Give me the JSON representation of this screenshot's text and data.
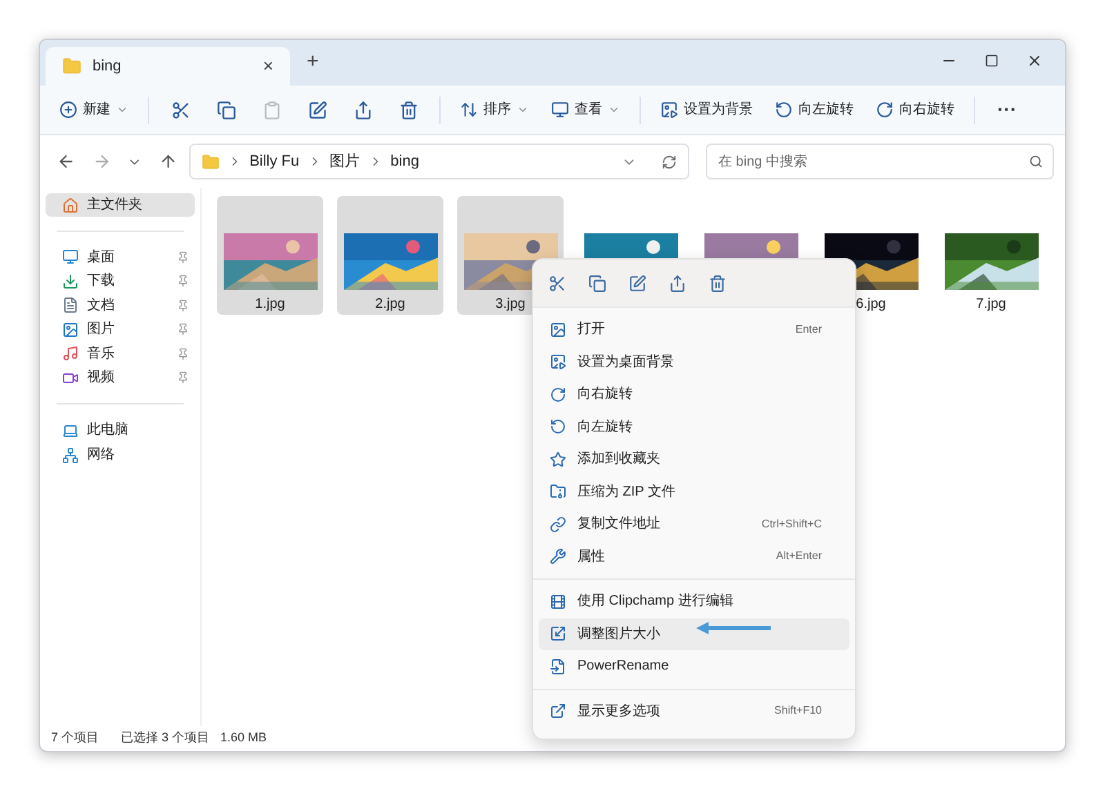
{
  "tab": {
    "title": "bing",
    "selected": true
  },
  "window_controls": {
    "close_tab": "×",
    "new_tab": "+"
  },
  "toolbar": {
    "new": {
      "label": "新建",
      "dropdown": true
    },
    "sort": {
      "label": "排序",
      "dropdown": true
    },
    "view": {
      "label": "查看",
      "dropdown": true
    },
    "set_background": {
      "label": "设置为背景"
    },
    "rotate_left": {
      "label": "向左旋转"
    },
    "rotate_right": {
      "label": "向右旋转"
    },
    "more": "···"
  },
  "breadcrumb": [
    "Billy Fu",
    "图片",
    "bing"
  ],
  "search": {
    "placeholder": "在 bing 中搜索"
  },
  "sidebar": {
    "home": {
      "label": "主文件夹",
      "selected": true
    },
    "pinned": [
      {
        "label": "桌面",
        "pinned": true
      },
      {
        "label": "下载",
        "pinned": true
      },
      {
        "label": "文档",
        "pinned": true
      },
      {
        "label": "图片",
        "pinned": true
      },
      {
        "label": "音乐",
        "pinned": true
      },
      {
        "label": "视频",
        "pinned": true
      }
    ],
    "locations": [
      {
        "label": "此电脑"
      },
      {
        "label": "网络"
      }
    ]
  },
  "files": [
    {
      "name": "1.jpg",
      "selected": true,
      "kind": "picture"
    },
    {
      "name": "2.jpg",
      "selected": true,
      "kind": "picture"
    },
    {
      "name": "3.jpg",
      "selected": true,
      "kind": "picture"
    },
    {
      "selected": false,
      "kind": "picture"
    },
    {
      "selected": false,
      "kind": "picture"
    },
    {
      "name": "6.jpg",
      "selected": false,
      "kind": "picture"
    },
    {
      "name": "7.jpg",
      "selected": false,
      "kind": "picture"
    }
  ],
  "context_menu": {
    "groups": [
      [
        {
          "label": "打开",
          "shortcut": "Enter",
          "selected": false
        },
        {
          "label": "设置为桌面背景",
          "selected": false
        },
        {
          "label": "向右旋转",
          "selected": false
        },
        {
          "label": "向左旋转",
          "selected": false
        },
        {
          "label": "添加到收藏夹",
          "selected": false
        },
        {
          "label": "压缩为 ZIP 文件",
          "selected": false
        },
        {
          "label": "复制文件地址",
          "shortcut": "Ctrl+Shift+C",
          "selected": false
        },
        {
          "label": "属性",
          "shortcut": "Alt+Enter",
          "selected": false
        }
      ],
      [
        {
          "label": "使用 Clipchamp 进行编辑",
          "selected": false
        },
        {
          "label": "调整图片大小",
          "selected": true
        },
        {
          "label": "PowerRename",
          "selected": false
        }
      ],
      [
        {
          "label": "显示更多选项",
          "shortcut": "Shift+F10",
          "selected": false
        }
      ]
    ]
  },
  "status_bar": {
    "count": "7 个项目",
    "selection": "已选择 3 个项目",
    "size": "1.60 MB"
  }
}
